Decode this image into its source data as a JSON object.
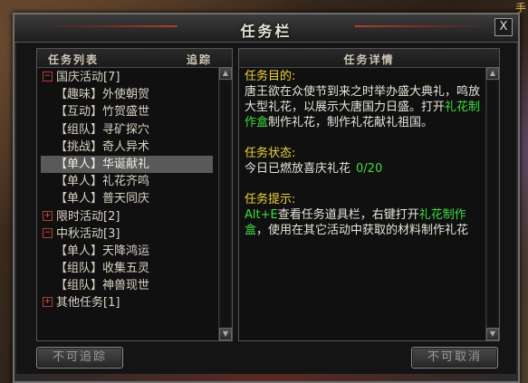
{
  "window": {
    "title": "任务栏",
    "close_label": "X"
  },
  "world": {
    "corner_text": "手"
  },
  "list_panel": {
    "header_list": "任务列表",
    "header_track": "追踪",
    "rows": [
      {
        "type": "cat",
        "expander": "⊟",
        "label": "国庆活动[7]"
      },
      {
        "type": "item",
        "label": "【趣味】外使朝贺"
      },
      {
        "type": "item",
        "label": "【互动】竹贺盛世"
      },
      {
        "type": "item",
        "label": "【组队】寻矿探穴"
      },
      {
        "type": "item",
        "label": "【挑战】奇人异术"
      },
      {
        "type": "item",
        "label": "【单人】华诞献礼",
        "selected": true
      },
      {
        "type": "item",
        "label": "【单人】礼花齐鸣"
      },
      {
        "type": "item",
        "label": "【单人】普天同庆"
      },
      {
        "type": "cat",
        "expander": "⊞",
        "label": "限时活动[2]"
      },
      {
        "type": "cat",
        "expander": "⊟",
        "label": "中秋活动[3]"
      },
      {
        "type": "item",
        "label": "【单人】天降鸿运"
      },
      {
        "type": "item",
        "label": "【组队】收集五灵"
      },
      {
        "type": "item",
        "label": "【组队】神兽现世"
      },
      {
        "type": "cat",
        "expander": "⊞",
        "label": "其他任务[1]"
      }
    ]
  },
  "detail_panel": {
    "header": "任务详情",
    "goal_heading": "任务目的:",
    "goal_text_1": "唐王欲在众使节到来之时举办盛大典礼，鸣放大型礼花，以展示大唐国力日盛。打开",
    "goal_link": "礼花制作盒",
    "goal_text_2": "制作礼花，制作礼花献礼祖国。",
    "status_heading": "任务状态:",
    "status_text": "今日已燃放喜庆礼花",
    "status_progress": "0/20",
    "hint_heading": "任务提示:",
    "hint_hotkey": "Alt+E",
    "hint_text_1": "查看任务道具栏，右键打开",
    "hint_link": "礼花制作盒",
    "hint_text_2": "，使用在其它活动中获取的材料制作礼花"
  },
  "buttons": {
    "left_label": "不可追踪",
    "right_label": "不可取消"
  },
  "colors": {
    "heading": "#f0d23a",
    "link": "#3fdc3f",
    "selected_row": "#595959"
  }
}
